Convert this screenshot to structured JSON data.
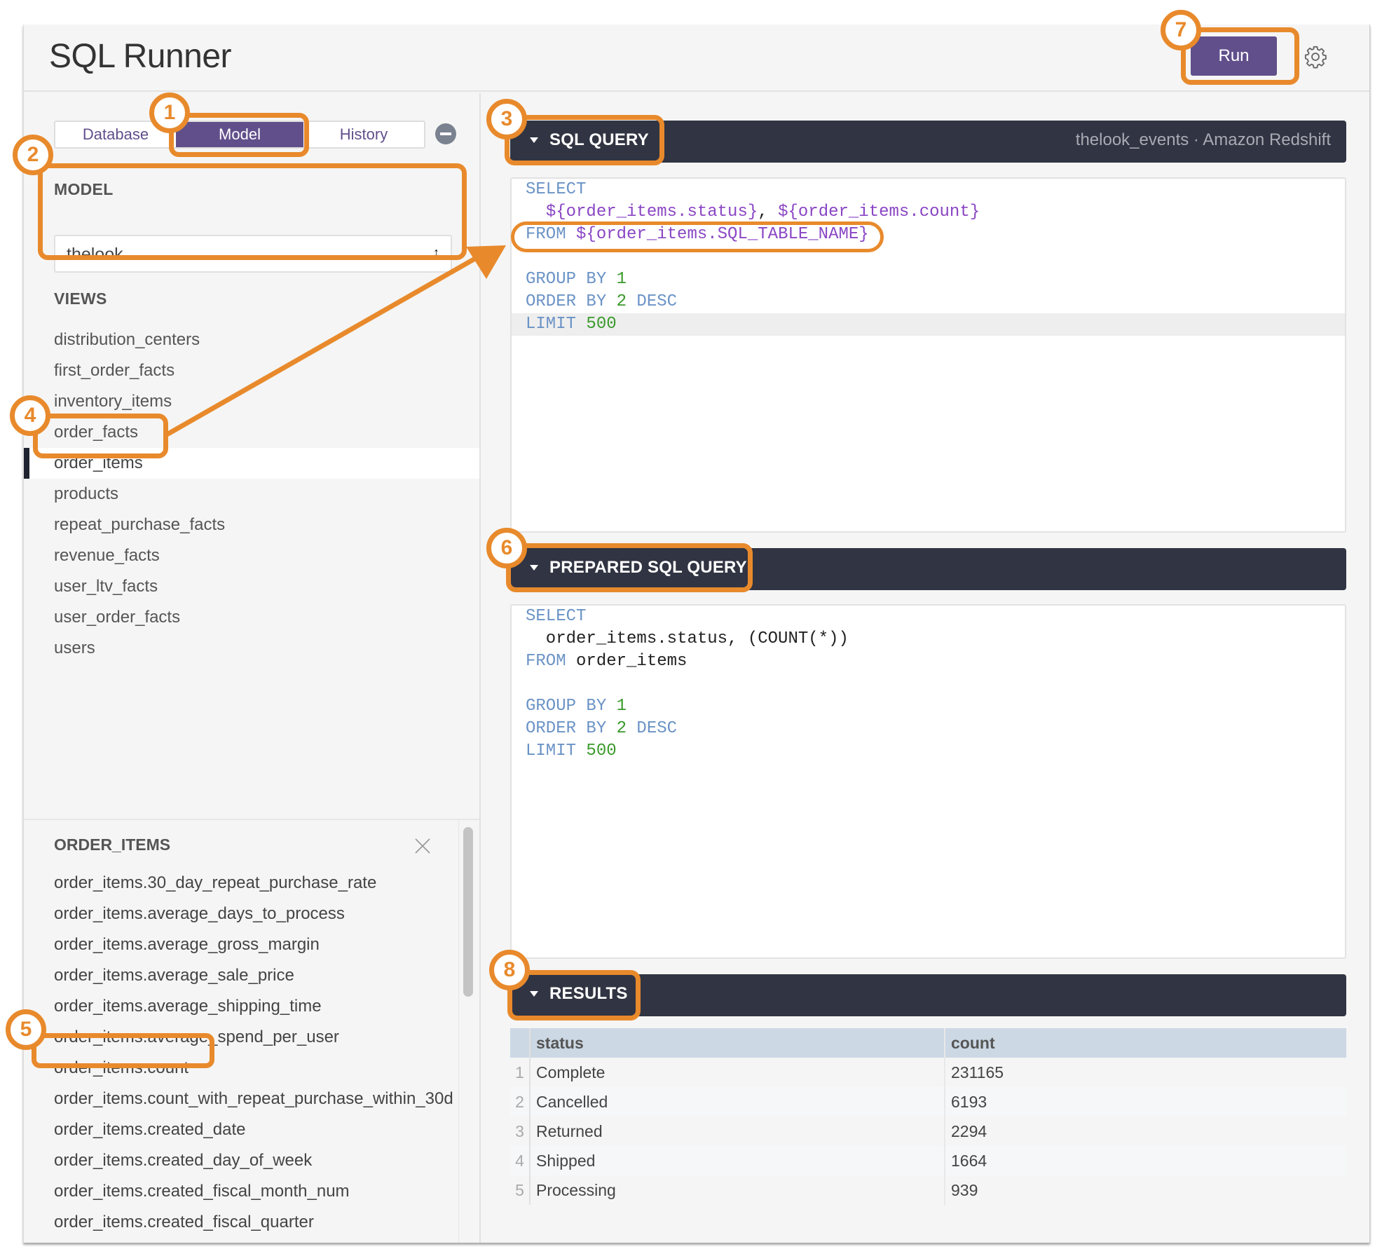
{
  "app": {
    "title": "SQL Runner"
  },
  "toolbar": {
    "run_label": "Run",
    "settings_icon": "gear-icon"
  },
  "sidebar": {
    "tabs": [
      {
        "label": "Database",
        "active": false
      },
      {
        "label": "Model",
        "active": true
      },
      {
        "label": "History",
        "active": false
      }
    ],
    "collapse_icon": "minus-circle-icon",
    "model_label": "MODEL",
    "model_select": {
      "value": "thelook"
    },
    "views_label": "VIEWS",
    "views": [
      "distribution_centers",
      "first_order_facts",
      "inventory_items",
      "order_facts",
      "order_items",
      "products",
      "repeat_purchase_facts",
      "revenue_facts",
      "user_ltv_facts",
      "user_order_facts",
      "users"
    ],
    "selected_view": "order_items",
    "fields_panel": {
      "title": "ORDER_ITEMS",
      "close_icon": "close-icon",
      "fields": [
        "order_items.30_day_repeat_purchase_rate",
        "order_items.average_days_to_process",
        "order_items.average_gross_margin",
        "order_items.average_sale_price",
        "order_items.average_shipping_time",
        "order_items.average_spend_per_user",
        "order_items.count",
        "order_items.count_with_repeat_purchase_within_30d",
        "order_items.created_date",
        "order_items.created_day_of_week",
        "order_items.created_fiscal_month_num",
        "order_items.created_fiscal_quarter"
      ]
    }
  },
  "sql_query": {
    "title": "SQL QUERY",
    "connection": "thelook_events · Amazon Redshift",
    "lines": [
      [
        {
          "t": "kw",
          "v": "SELECT"
        }
      ],
      [
        {
          "t": "plain",
          "v": "  "
        },
        {
          "t": "var",
          "v": "${order_items.status}"
        },
        {
          "t": "plain",
          "v": ", "
        },
        {
          "t": "var",
          "v": "${order_items.count}"
        }
      ],
      [
        {
          "t": "kw",
          "v": "FROM "
        },
        {
          "t": "var",
          "v": "${order_items.SQL_TABLE_NAME}"
        }
      ],
      [],
      [
        {
          "t": "kw",
          "v": "GROUP BY "
        },
        {
          "t": "num",
          "v": "1"
        }
      ],
      [
        {
          "t": "kw",
          "v": "ORDER BY "
        },
        {
          "t": "num",
          "v": "2"
        },
        {
          "t": "kw",
          "v": " DESC"
        }
      ],
      [
        {
          "t": "kw",
          "v": "LIMIT "
        },
        {
          "t": "num",
          "v": "500"
        }
      ]
    ],
    "active_line": 6
  },
  "prepared_query": {
    "title": "PREPARED SQL QUERY",
    "lines": [
      [
        {
          "t": "kw",
          "v": "SELECT"
        }
      ],
      [
        {
          "t": "plain",
          "v": "  order_items.status, (COUNT(*))"
        }
      ],
      [
        {
          "t": "kw",
          "v": "FROM "
        },
        {
          "t": "plain",
          "v": "order_items"
        }
      ],
      [],
      [
        {
          "t": "kw",
          "v": "GROUP BY "
        },
        {
          "t": "num",
          "v": "1"
        }
      ],
      [
        {
          "t": "kw",
          "v": "ORDER BY "
        },
        {
          "t": "num",
          "v": "2"
        },
        {
          "t": "kw",
          "v": " DESC"
        }
      ],
      [
        {
          "t": "kw",
          "v": "LIMIT "
        },
        {
          "t": "num",
          "v": "500"
        }
      ]
    ]
  },
  "results": {
    "title": "RESULTS",
    "columns": [
      "status",
      "count"
    ],
    "rows": [
      {
        "index": "1",
        "status": "Complete",
        "count": "231165"
      },
      {
        "index": "2",
        "status": "Cancelled",
        "count": "6193"
      },
      {
        "index": "3",
        "status": "Returned",
        "count": "2294"
      },
      {
        "index": "4",
        "status": "Shipped",
        "count": "1664"
      },
      {
        "index": "5",
        "status": "Processing",
        "count": "939"
      }
    ]
  },
  "annotations": {
    "color": "#e88a2c",
    "badges": [
      "1",
      "2",
      "3",
      "4",
      "5",
      "6",
      "7",
      "8"
    ]
  },
  "colors": {
    "brand_purple": "#614f8b",
    "dark_bar": "#313442",
    "keyword": "#6b93c6",
    "number": "#3a9a2a",
    "variable": "#8a46c4",
    "table_header": "#ccd8e4"
  }
}
